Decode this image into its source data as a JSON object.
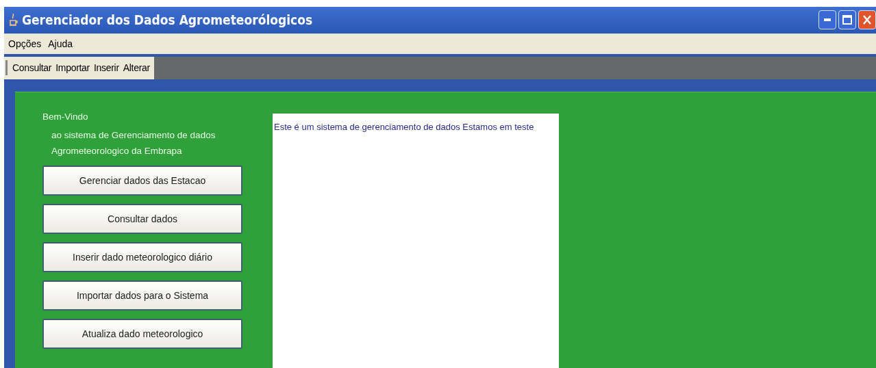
{
  "window": {
    "title": "Gerenciador dos Dados Agrometeorólogicos"
  },
  "menu": [
    "Opções",
    "Ajuda"
  ],
  "toolbar": [
    "Consultar",
    "Importar",
    "Inserir",
    "Alterar"
  ],
  "welcome": {
    "title": "Bem-Vindo",
    "lines": [
      "ao sistema de Gerenciamento de dados",
      "Agrometeorologico da Embrapa"
    ]
  },
  "buttons": [
    "Gerenciar dados das Estacao",
    "Consultar dados",
    "Inserir dado meteorologico diário",
    "Importar dados para o Sistema",
    "Atualiza dado meteorologico"
  ],
  "text_area": {
    "value": "Este é um sistema de gerenciamento de dados Estamos em teste"
  }
}
